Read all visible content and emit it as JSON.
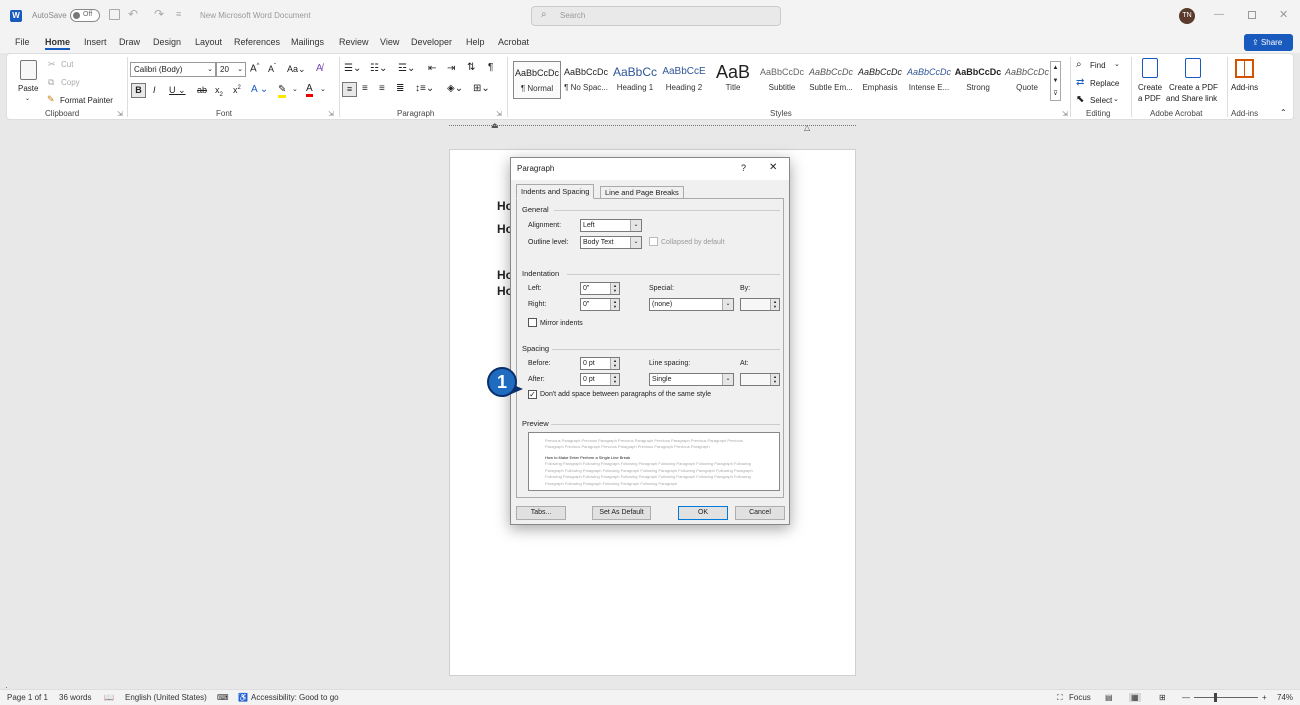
{
  "titlebar": {
    "autosave_label": "AutoSave",
    "autosave_state": "Off",
    "doc_title": "New Microsoft Word Document",
    "search_placeholder": "Search",
    "user_initials": "TN"
  },
  "tabs": [
    "File",
    "Home",
    "Insert",
    "Draw",
    "Design",
    "Layout",
    "References",
    "Mailings",
    "Review",
    "View",
    "Developer",
    "Help",
    "Acrobat"
  ],
  "share_label": "Share",
  "clipboard": {
    "paste": "Paste",
    "cut": "Cut",
    "copy": "Copy",
    "format_painter": "Format Painter",
    "group": "Clipboard"
  },
  "font": {
    "name": "Calibri (Body)",
    "size": "20",
    "group": "Font"
  },
  "paragraph_group": "Paragraph",
  "styles": {
    "group": "Styles",
    "items": [
      {
        "sample": "AaBbCcDc",
        "name": "¶ Normal"
      },
      {
        "sample": "AaBbCcDc",
        "name": "¶ No Spac..."
      },
      {
        "sample": "AaBbCc",
        "name": "Heading 1"
      },
      {
        "sample": "AaBbCcE",
        "name": "Heading 2"
      },
      {
        "sample": "AaB",
        "name": "Title"
      },
      {
        "sample": "AaBbCcDc",
        "name": "Subtitle"
      },
      {
        "sample": "AaBbCcDc",
        "name": "Subtle Em..."
      },
      {
        "sample": "AaBbCcDc",
        "name": "Emphasis"
      },
      {
        "sample": "AaBbCcDc",
        "name": "Intense E..."
      },
      {
        "sample": "AaBbCcDc",
        "name": "Strong"
      },
      {
        "sample": "AaBbCcDc",
        "name": "Quote"
      }
    ]
  },
  "editing": {
    "find": "Find",
    "replace": "Replace",
    "select": "Select",
    "group": "Editing"
  },
  "acrobat": {
    "create_pdf_1": "Create",
    "create_pdf_2": "a PDF",
    "share_pdf_1": "Create a PDF",
    "share_pdf_2": "and Share link",
    "group": "Adobe Acrobat"
  },
  "addins": {
    "label": "Add-ins",
    "group": "Add-ins"
  },
  "document": {
    "lines": [
      "Ho",
      "Ho",
      "Ho",
      "Ho"
    ]
  },
  "dialog": {
    "title": "Paragraph",
    "help": "?",
    "close": "✕",
    "tab_indents": "Indents and Spacing",
    "tab_breaks": "Line and Page Breaks",
    "general": "General",
    "alignment_label": "Alignment:",
    "alignment_value": "Left",
    "outline_label": "Outline level:",
    "outline_value": "Body Text",
    "collapsed_label": "Collapsed by default",
    "indentation": "Indentation",
    "left_label": "Left:",
    "left_value": "0\"",
    "right_label": "Right:",
    "right_value": "0\"",
    "special_label": "Special:",
    "special_value": "(none)",
    "by_label": "By:",
    "mirror_label": "Mirror indents",
    "spacing": "Spacing",
    "before_label": "Before:",
    "before_value": "0 pt",
    "after_label": "After:",
    "after_value": "0 pt",
    "line_spacing_label": "Line spacing:",
    "line_spacing_value": "Single",
    "at_label": "At:",
    "dont_add_label": "Don't add space between paragraphs of the same style",
    "preview": "Preview",
    "preview_prev": "Previous Paragraph Previous Paragraph Previous Paragraph Previous Paragraph Previous Paragraph Previous Paragraph Previous Paragraph Previous Paragraph Previous Paragraph Previous Paragraph",
    "preview_sample": "How to Make Enter Perform a Single Line Break",
    "preview_next": "Following Paragraph Following Paragraph Following Paragraph Following Paragraph Following Paragraph Following Paragraph Following Paragraph Following Paragraph Following Paragraph Following Paragraph Following Paragraph Following Paragraph Following Paragraph Following Paragraph Following Paragraph Following Paragraph Following Paragraph Following Paragraph Following Paragraph Following Paragraph",
    "tabs_btn": "Tabs...",
    "default_btn": "Set As Default",
    "ok_btn": "OK",
    "cancel_btn": "Cancel"
  },
  "callout": "1",
  "status": {
    "page": "Page 1 of 1",
    "words": "36 words",
    "language": "English (United States)",
    "accessibility": "Accessibility: Good to go",
    "focus": "Focus",
    "zoom": "74%"
  },
  "colors": {
    "accent": "#185abd",
    "callout": "#1e6bbf"
  }
}
